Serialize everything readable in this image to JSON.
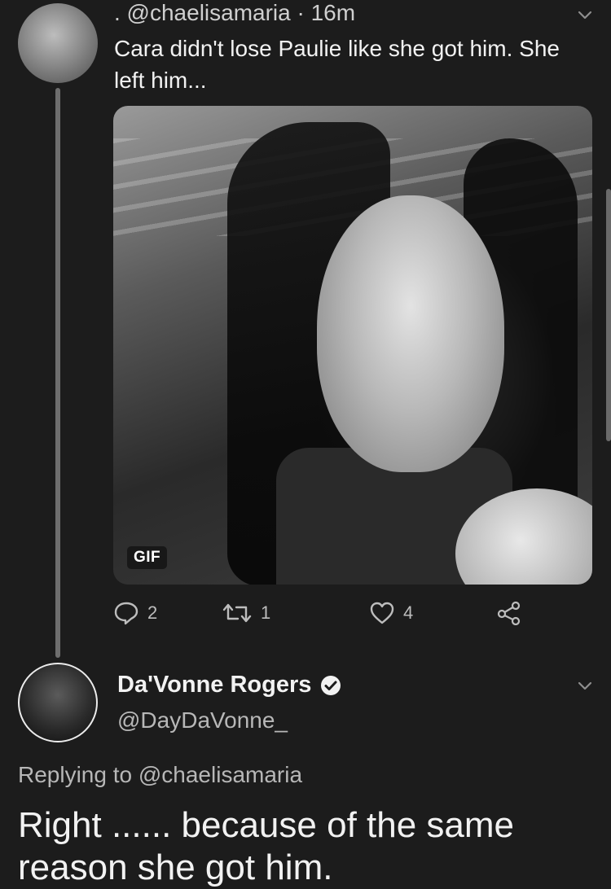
{
  "tweet": {
    "handle_line": ". @chaelisamaria · 16m",
    "text": "Cara didn't lose Paulie like she got him. She left him...",
    "media_badge": "GIF",
    "actions": {
      "replies": "2",
      "retweets": "1",
      "likes": "4"
    }
  },
  "reply": {
    "name": "Da'Vonne Rogers",
    "handle": "@DayDaVonne_",
    "replying_to": "Replying to @chaelisamaria",
    "text": "Right ...... because of the same reason she got him."
  },
  "icons": {
    "reply": "speech-bubble-icon",
    "retweet": "retweet-icon",
    "like": "heart-icon",
    "share": "share-icon",
    "more": "chevron-down-icon",
    "verified": "verified-badge-icon"
  }
}
